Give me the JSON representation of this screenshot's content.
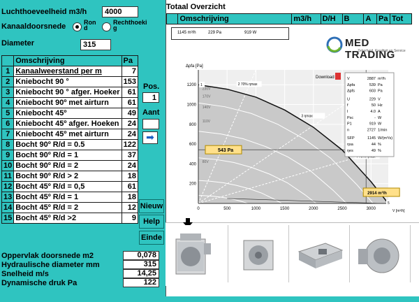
{
  "left": {
    "airflow_label": "Luchthoeveelheid m3/h",
    "airflow_value": "4000",
    "section_label": "Kanaaldoorsnede",
    "round_label": "Ron d",
    "rect_label": "Rechthoeki g",
    "diameter_label": "Diameter",
    "diameter_value": "315",
    "col_desc": "Omschrijving",
    "col_pa": "Pa",
    "rows": [
      {
        "no": "1",
        "desc": "Kanaalweerstand per m",
        "pa": "7"
      },
      {
        "no": "2",
        "desc": "Kniebocht 90 °",
        "pa": "153"
      },
      {
        "no": "3",
        "desc": "Kniebocht 90 ° afger. Hoeker",
        "pa": "61"
      },
      {
        "no": "4",
        "desc": "Kniebocht 90º met airturn",
        "pa": "61"
      },
      {
        "no": "5",
        "desc": "Kniebocht 45º",
        "pa": "49"
      },
      {
        "no": "6",
        "desc": "Kniebocht 45º afger. Hoeken",
        "pa": "24"
      },
      {
        "no": "7",
        "desc": "Kniebocht 45º met airturn",
        "pa": "24"
      },
      {
        "no": "8",
        "desc": "Bocht 90º R/d = 0.5",
        "pa": "122"
      },
      {
        "no": "9",
        "desc": "Bocht 90º R/d = 1",
        "pa": "37"
      },
      {
        "no": "10",
        "desc": "Bocht 90º R/d = 2",
        "pa": "24"
      },
      {
        "no": "11",
        "desc": "Bocht 90º R/d > 2",
        "pa": "18"
      },
      {
        "no": "12",
        "desc": "Bocht 45º R/d = 0,5",
        "pa": "61"
      },
      {
        "no": "13",
        "desc": "Bocht 45º R/d = 1",
        "pa": "18"
      },
      {
        "no": "14",
        "desc": "Bocht 45º R/d = 2",
        "pa": "12"
      },
      {
        "no": "15",
        "desc": "Bocht 45º R/d >2",
        "pa": "9"
      }
    ],
    "pos_label": "Pos.",
    "pos_value": "1",
    "aant_label": "Aant",
    "aant_value": "",
    "arrow_glyph": "➡",
    "btn_nieuw": "Nieuw",
    "btn_help": "Help",
    "btn_einde": "Einde",
    "stats": [
      {
        "label": "Oppervlak doorsnede m2",
        "value": "0,078"
      },
      {
        "label": "Hydraulische diameter mm",
        "value": "315"
      },
      {
        "label": "Snelheid m/s",
        "value": "14,25"
      },
      {
        "label": "Dynamische druk Pa",
        "value": "122"
      }
    ]
  },
  "right": {
    "title": "Totaal Overzicht",
    "headers": [
      "Omschrijving",
      "m3/h",
      "D/H",
      "B",
      "A",
      "Pa",
      "Tot"
    ],
    "summary_flow": "1145 m³/h",
    "summary_pa": "229 Pa",
    "summary_w": "919 W",
    "logo_main": "MED TRADING",
    "logo_sub": "Zekerheid, Kwaliteit en Service",
    "download": "Download",
    "icons": {
      "pdf": "pdf-icon",
      "arrow": "down-arrow-icon"
    }
  },
  "chart_data": {
    "type": "line",
    "xlabel": "V [m³/h]",
    "ylabel": "Δpfa [Pa]",
    "xlim": [
      0,
      3300
    ],
    "ylim": [
      0,
      1350
    ],
    "x_ticks": [
      0,
      500,
      1000,
      1500,
      2000,
      2500,
      3000
    ],
    "y_ticks": [
      200,
      400,
      600,
      800,
      1000,
      1200
    ],
    "series": [
      {
        "name": "",
        "x": [
          0,
          500,
          1000,
          1500,
          2000,
          2500,
          3000,
          3300
        ],
        "y": [
          1200,
          1155,
          1075,
          945,
          770,
          540,
          220,
          0
        ]
      }
    ],
    "voltage_labels": [
      "230V",
      "170V",
      "140V",
      "110V",
      "80V"
    ],
    "curve_markers": [
      {
        "label": "1",
        "x": 50,
        "y": 1195
      },
      {
        "label": "2 70% ηmax",
        "x": 700,
        "y": 1200
      },
      {
        "label": "3 ηmax",
        "x": 1800,
        "y": 880
      },
      {
        "label": "4 70% ηmax",
        "x": 2750,
        "y": 470
      },
      {
        "label": "5",
        "x": 3300,
        "y": 0
      }
    ],
    "pressure_readout": "543 Pa",
    "flow_readout": "2914 m³/h",
    "operating_point": {
      "x": 2914,
      "y": 543
    },
    "info": {
      "V": "2887",
      "V_unit": "m³/h",
      "dpfa": "539",
      "dpfa_unit": "Pa",
      "dpfs": "603",
      "dpfs_unit": "Pa",
      "U": "229",
      "U_unit": "V",
      "f": "50",
      "f_unit": "Hz",
      "I": "4.0",
      "I_unit": "A",
      "Psc": "-",
      "Psc_unit": "W",
      "P1": "919",
      "P1_unit": "W",
      "n": "2727",
      "n_unit": "1/min",
      "SFP": "1145",
      "SFP_unit": "W/(m³/s)",
      "nsa": "44",
      "nsa_unit": "%",
      "nes": "49",
      "nes_unit": "%"
    }
  },
  "thumbs": [
    "fan-box-product-1",
    "fan-box-product-2",
    "fan-unit-product-3",
    "fan-wheel-product-4"
  ]
}
